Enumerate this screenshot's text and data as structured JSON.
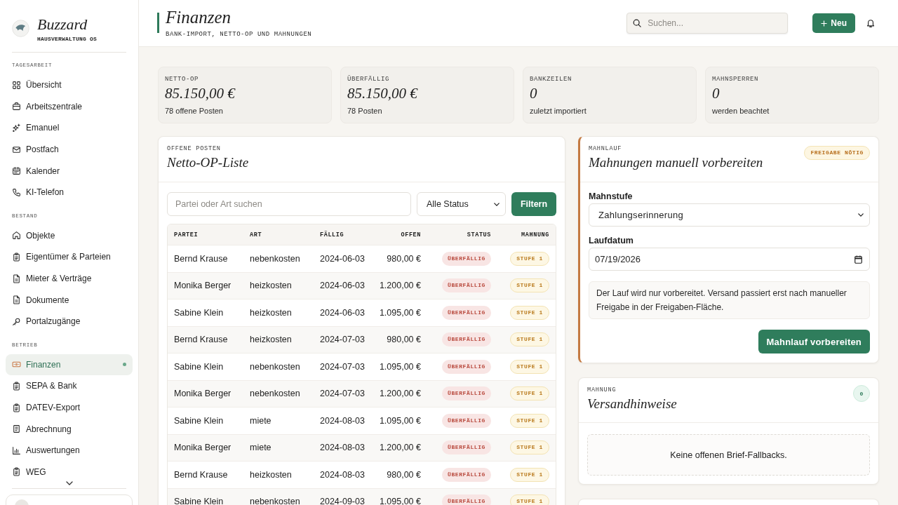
{
  "sidebar": {
    "brand": {
      "name": "Buzzard",
      "subtitle": "HAUSVERWALTUNG OS"
    },
    "groups": [
      {
        "title": "TAGESARBEIT",
        "items": [
          {
            "label": "Übersicht",
            "selected": false
          },
          {
            "label": "Arbeitszentrale",
            "selected": false
          },
          {
            "label": "Emanuel",
            "selected": false
          },
          {
            "label": "Postfach",
            "selected": false
          },
          {
            "label": "Kalender",
            "selected": false
          },
          {
            "label": "KI-Telefon",
            "selected": false
          }
        ]
      },
      {
        "title": "BESTAND",
        "items": [
          {
            "label": "Objekte",
            "selected": false
          },
          {
            "label": "Eigentümer & Parteien",
            "selected": false
          },
          {
            "label": "Mieter & Verträge",
            "selected": false
          },
          {
            "label": "Dokumente",
            "selected": false
          },
          {
            "label": "Portalzugänge",
            "selected": false
          }
        ]
      },
      {
        "title": "BETRIEB",
        "items": [
          {
            "label": "Finanzen",
            "selected": true
          },
          {
            "label": "SEPA & Bank",
            "selected": false
          },
          {
            "label": "DATEV-Export",
            "selected": false
          },
          {
            "label": "Abrechnung",
            "selected": false
          },
          {
            "label": "Auswertungen",
            "selected": false
          },
          {
            "label": "WEG",
            "selected": false
          }
        ]
      }
    ]
  },
  "header": {
    "title": "Finanzen",
    "subtitle": "BANK-IMPORT, NETTO-OP UND MAHNUNGEN",
    "search": {
      "placeholder": "Suchen..."
    },
    "new_button": "Neu"
  },
  "stats": [
    {
      "label": "NETTO-OP",
      "value": "85.150,00 €",
      "note": "78 offene Posten"
    },
    {
      "label": "ÜBERFÄLLIG",
      "value": "85.150,00 €",
      "note": "78 Posten"
    },
    {
      "label": "BANKZEILEN",
      "value": "0",
      "note": "zuletzt importiert"
    },
    {
      "label": "MAHNSPERREN",
      "value": "0",
      "note": "werden beachtet"
    }
  ],
  "op_list": {
    "eyebrow": "OFFENE POSTEN",
    "title": "Netto-OP-Liste",
    "filter": {
      "placeholder": "Partei oder Art suchen",
      "status": "Alle Status",
      "button": "Filtern"
    },
    "table": {
      "columns": [
        "PARTEI",
        "ART",
        "FÄLLIG",
        "OFFEN",
        "STATUS",
        "MAHNUNG"
      ],
      "rows": [
        {
          "partei": "Bernd Krause",
          "art": "nebenkosten",
          "faellig": "2024-06-03",
          "offen": "980,00 €",
          "status": "ÜBERFÄLLIG",
          "mahnung": "STUFE 1"
        },
        {
          "partei": "Monika Berger",
          "art": "heizkosten",
          "faellig": "2024-06-03",
          "offen": "1.200,00 €",
          "status": "ÜBERFÄLLIG",
          "mahnung": "STUFE 1"
        },
        {
          "partei": "Sabine Klein",
          "art": "heizkosten",
          "faellig": "2024-06-03",
          "offen": "1.095,00 €",
          "status": "ÜBERFÄLLIG",
          "mahnung": "STUFE 1"
        },
        {
          "partei": "Bernd Krause",
          "art": "heizkosten",
          "faellig": "2024-07-03",
          "offen": "980,00 €",
          "status": "ÜBERFÄLLIG",
          "mahnung": "STUFE 1"
        },
        {
          "partei": "Sabine Klein",
          "art": "nebenkosten",
          "faellig": "2024-07-03",
          "offen": "1.095,00 €",
          "status": "ÜBERFÄLLIG",
          "mahnung": "STUFE 1"
        },
        {
          "partei": "Monika Berger",
          "art": "nebenkosten",
          "faellig": "2024-07-03",
          "offen": "1.200,00 €",
          "status": "ÜBERFÄLLIG",
          "mahnung": "STUFE 1"
        },
        {
          "partei": "Sabine Klein",
          "art": "miete",
          "faellig": "2024-08-03",
          "offen": "1.095,00 €",
          "status": "ÜBERFÄLLIG",
          "mahnung": "STUFE 1"
        },
        {
          "partei": "Monika Berger",
          "art": "miete",
          "faellig": "2024-08-03",
          "offen": "1.200,00 €",
          "status": "ÜBERFÄLLIG",
          "mahnung": "STUFE 1"
        },
        {
          "partei": "Bernd Krause",
          "art": "heizkosten",
          "faellig": "2024-08-03",
          "offen": "980,00 €",
          "status": "ÜBERFÄLLIG",
          "mahnung": "STUFE 1"
        },
        {
          "partei": "Sabine Klein",
          "art": "nebenkosten",
          "faellig": "2024-09-03",
          "offen": "1.095,00 €",
          "status": "ÜBERFÄLLIG",
          "mahnung": "STUFE 1"
        }
      ]
    }
  },
  "dunning_run": {
    "eyebrow": "MAHNLAUF",
    "title": "Mahnungen manuell vorbereiten",
    "badge": "FREIGABE NÖTIG",
    "fields": [
      {
        "kind": "select",
        "label": "Mahnstufe",
        "value": "Zahlungserinnerung"
      },
      {
        "kind": "date",
        "label": "Laufdatum",
        "value": "07/19/2026"
      }
    ],
    "note": "Der Lauf wird nur vorbereitet. Versand passiert erst nach manueller Freigabe in der Freigaben-Fläche.",
    "button": "Mahnlauf vorbereiten"
  },
  "shipping_notes": {
    "eyebrow": "MAHNUNG",
    "title": "Versandhinweise",
    "count": "0",
    "empty_text": "Keine offenen Brief-Fallbacks."
  }
}
